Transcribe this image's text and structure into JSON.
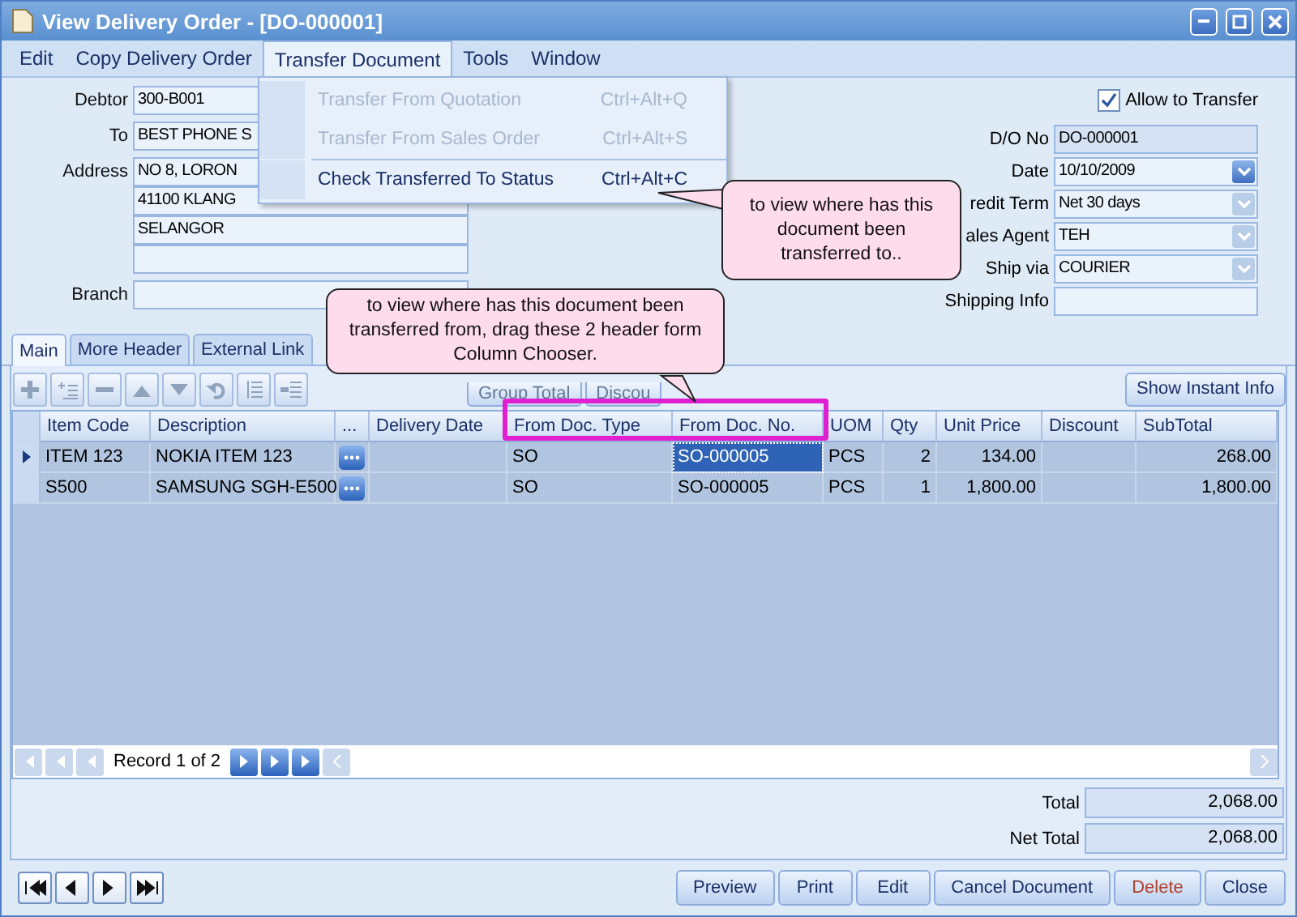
{
  "window": {
    "title": "View Delivery Order - [DO-000001]"
  },
  "menu": [
    {
      "label": "Edit",
      "selected": false
    },
    {
      "label": "Copy Delivery Order",
      "selected": false
    },
    {
      "label": "Transfer Document",
      "selected": true
    },
    {
      "label": "Tools",
      "selected": false
    },
    {
      "label": "Window",
      "selected": false
    }
  ],
  "dropdown": [
    {
      "label": "Transfer From Quotation",
      "shortcut": "Ctrl+Alt+Q",
      "disabled": true
    },
    {
      "label": "Transfer From Sales Order",
      "shortcut": "Ctrl+Alt+S",
      "disabled": true
    },
    {
      "label": "Check Transferred To Status",
      "shortcut": "Ctrl+Alt+C",
      "disabled": false
    }
  ],
  "header_left": [
    {
      "label": "Debtor",
      "value": "300-B001"
    },
    {
      "label": "To",
      "value": "BEST PHONE S"
    },
    {
      "label": "Address",
      "lines": [
        "NO 8, LORON",
        "41100 KLANG",
        "SELANGOR"
      ]
    },
    {
      "label": "Branch"
    }
  ],
  "allow_transfer": {
    "label": "Allow to Transfer",
    "checked": true
  },
  "header_right": [
    {
      "label": "D/O No",
      "value": "DO-000001",
      "kind": "text"
    },
    {
      "label": "Date",
      "value": "10/10/2009",
      "kind": "dropdown",
      "disabled": false
    },
    {
      "label": "redit Term",
      "value": "Net 30 days",
      "kind": "dropdown",
      "disabled": true
    },
    {
      "label": "ales Agent",
      "value": "TEH",
      "kind": "dropdown",
      "disabled": true
    },
    {
      "label": "Ship via",
      "value": "COURIER",
      "kind": "dropdown",
      "disabled": true
    },
    {
      "label": "Shipping Info",
      "kind": "text"
    }
  ],
  "tabs": [
    {
      "label": "Main",
      "selected": true
    },
    {
      "label": "More Header",
      "selected": false
    },
    {
      "label": "External Link",
      "selected": false
    }
  ],
  "toolbar_buttons": [
    {
      "label": "Group Total",
      "disabled": true
    },
    {
      "label": "Discou",
      "disabled": true
    }
  ],
  "instant_info_button": {
    "label": "Show Instant Info"
  },
  "table": {
    "columns": [
      {
        "label": "Item Code",
        "kind": "text"
      },
      {
        "label": "Description",
        "kind": "text"
      },
      {
        "label": "...",
        "kind": "button"
      },
      {
        "label": "Delivery Date",
        "kind": "text"
      },
      {
        "label": "From Doc. Type",
        "kind": "text"
      },
      {
        "label": "From Doc. No.",
        "kind": "text"
      },
      {
        "label": "UOM",
        "kind": "text"
      },
      {
        "label": "Qty",
        "kind": "number"
      },
      {
        "label": "Unit Price",
        "kind": "number"
      },
      {
        "label": "Discount",
        "kind": "number"
      },
      {
        "label": "SubTotal",
        "kind": "number"
      }
    ],
    "rows": [
      {
        "current": true,
        "cells": [
          {
            "text": "ITEM 123",
            "focused": false
          },
          {
            "text": "NOKIA ITEM 123",
            "focused": false
          },
          {},
          {
            "focused": false
          },
          {
            "text": "SO",
            "focused": false
          },
          {
            "text": "SO-000005",
            "focused": true
          },
          {
            "text": "PCS",
            "focused": false
          },
          {
            "text": "2",
            "focused": false
          },
          {
            "text": "134.00",
            "focused": false
          },
          {
            "focused": false
          },
          {
            "text": "268.00",
            "focused": false
          }
        ]
      },
      {
        "current": false,
        "cells": [
          {
            "text": "S500",
            "focused": false
          },
          {
            "text": "SAMSUNG SGH-E500",
            "focused": false
          },
          {},
          {
            "focused": false
          },
          {
            "text": "SO",
            "focused": false
          },
          {
            "text": "SO-000005",
            "focused": false
          },
          {
            "text": "PCS",
            "focused": false
          },
          {
            "text": "1",
            "focused": false
          },
          {
            "text": "1,800.00",
            "focused": false
          },
          {
            "focused": false
          },
          {
            "text": "1,800.00",
            "focused": false
          }
        ]
      }
    ]
  },
  "navigator": {
    "record": "Record 1 of 2"
  },
  "totals": [
    {
      "label": "Total",
      "value": "2,068.00"
    },
    {
      "label": "Net Total",
      "value": "2,068.00"
    }
  ],
  "buttons": [
    {
      "label": "Preview",
      "kind": "normal"
    },
    {
      "label": "Print",
      "kind": "normal"
    },
    {
      "label": "Edit",
      "kind": "normal"
    },
    {
      "label": "Cancel Document",
      "kind": "normal"
    },
    {
      "label": "Delete",
      "kind": "danger"
    },
    {
      "label": "Close",
      "kind": "normal"
    }
  ],
  "callouts": [
    {
      "text": "to view where has this document been transferred to.."
    },
    {
      "text": "to view where has this document been transferred from, drag these 2 header form Column Chooser."
    }
  ]
}
